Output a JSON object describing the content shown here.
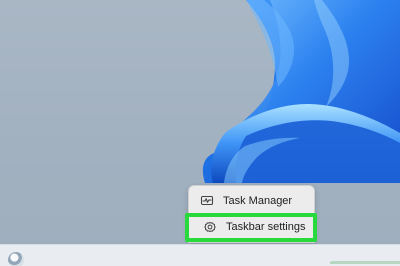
{
  "context_menu": {
    "items": [
      {
        "label": "Task Manager",
        "icon": "task-manager-icon",
        "highlighted": false
      },
      {
        "label": "Taskbar settings",
        "icon": "gear-icon",
        "highlighted": true
      }
    ]
  },
  "colors": {
    "highlight_border": "#27d93b",
    "menu_background": "#ececec",
    "wallpaper_blue": "#1b66d9",
    "wallpaper_gray": "#a3b2c1",
    "taskbar_background": "#e9edf2"
  }
}
